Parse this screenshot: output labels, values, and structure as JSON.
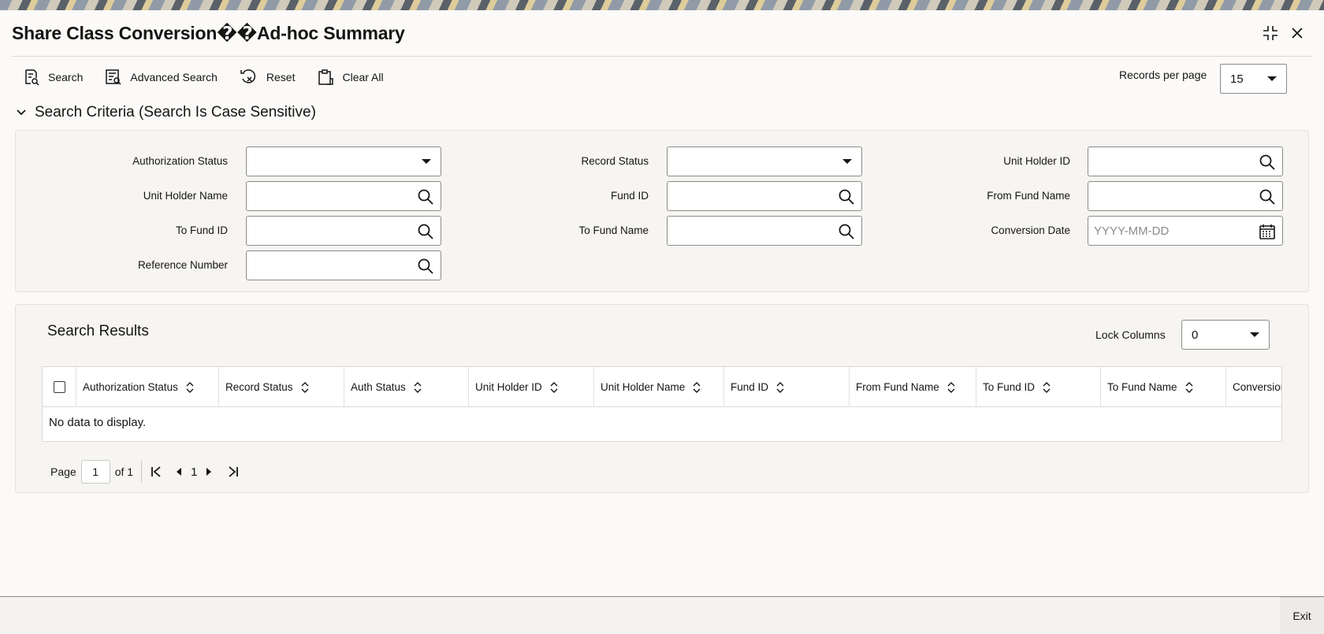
{
  "window": {
    "title": "Share Class Conversion��Ad-hoc Summary"
  },
  "toolbar": {
    "search_label": "Search",
    "advanced_search_label": "Advanced Search",
    "reset_label": "Reset",
    "clear_all_label": "Clear All",
    "records_per_page_label": "Records per page",
    "records_per_page_value": "15"
  },
  "criteria": {
    "heading": "Search Criteria (Search Is Case Sensitive)",
    "fields": {
      "authorization_status": {
        "label": "Authorization Status",
        "value": ""
      },
      "record_status": {
        "label": "Record Status",
        "value": ""
      },
      "unit_holder_id": {
        "label": "Unit Holder ID",
        "value": ""
      },
      "unit_holder_name": {
        "label": "Unit Holder Name",
        "value": ""
      },
      "fund_id": {
        "label": "Fund ID",
        "value": ""
      },
      "from_fund_name": {
        "label": "From Fund Name",
        "value": ""
      },
      "to_fund_id": {
        "label": "To Fund ID",
        "value": ""
      },
      "to_fund_name": {
        "label": "To Fund Name",
        "value": ""
      },
      "conversion_date": {
        "label": "Conversion Date",
        "placeholder": "YYYY-MM-DD"
      },
      "reference_number": {
        "label": "Reference Number",
        "value": ""
      }
    }
  },
  "results": {
    "heading": "Search Results",
    "lock_columns_label": "Lock Columns",
    "lock_columns_value": "0",
    "columns": [
      "Authorization Status",
      "Record Status",
      "Auth Status",
      "Unit Holder ID",
      "Unit Holder Name",
      "Fund ID",
      "From Fund Name",
      "To Fund ID",
      "To Fund Name",
      "Conversion"
    ],
    "empty_message": "No data to display."
  },
  "pager": {
    "page_label": "Page",
    "page_value": "1",
    "of_label": "of 1",
    "current_page": "1"
  },
  "footer": {
    "exit_label": "Exit"
  },
  "icons": {
    "search": "search-icon",
    "advanced_search": "advanced-search-icon",
    "reset": "reset-icon",
    "clear_all": "clipboard-icon",
    "calendar": "calendar-icon",
    "sort": "sort-icon",
    "maximize": "collapse-icon",
    "close": "close-icon"
  }
}
